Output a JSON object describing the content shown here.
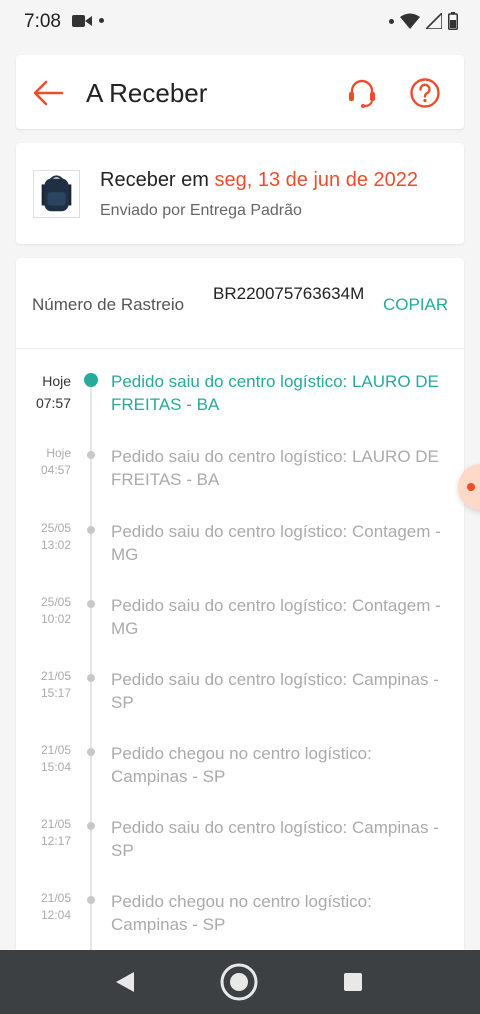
{
  "status_bar": {
    "time": "7:08"
  },
  "header": {
    "title": "A Receber"
  },
  "delivery": {
    "prefix": "Receber em",
    "date": "seg, 13 de jun de 2022",
    "shipping": "Enviado por Entrega Padrão"
  },
  "tracking": {
    "label": "Número de Rastreio",
    "number": "BR220075763634M",
    "copy_label": "COPIAR",
    "events": [
      {
        "day": "Hoje",
        "time": "07:57",
        "text": "Pedido saiu do centro logístico: LAURO DE FREITAS - BA",
        "active": true
      },
      {
        "day": "Hoje",
        "time": "04:57",
        "text": "Pedido saiu do centro logístico: LAURO DE FREITAS - BA"
      },
      {
        "day": "25/05",
        "time": "13:02",
        "text": "Pedido saiu do centro logístico: Contagem - MG"
      },
      {
        "day": "25/05",
        "time": "10:02",
        "text": "Pedido saiu do centro logístico: Contagem - MG"
      },
      {
        "day": "21/05",
        "time": "15:17",
        "text": "Pedido saiu do centro logístico: Campinas - SP"
      },
      {
        "day": "21/05",
        "time": "15:04",
        "text": "Pedido chegou no centro logístico: Campinas - SP"
      },
      {
        "day": "21/05",
        "time": "12:17",
        "text": "Pedido saiu do centro logístico: Campinas - SP"
      },
      {
        "day": "21/05",
        "time": "12:04",
        "text": "Pedido chegou no centro logístico: Campinas - SP"
      }
    ]
  },
  "colors": {
    "brand": "#ee4d2d",
    "accent": "#26aa99",
    "muted": "#aaaaaa"
  },
  "icons": {
    "back": "arrow-left-icon",
    "support": "headset-icon",
    "help": "question-circle-icon"
  }
}
